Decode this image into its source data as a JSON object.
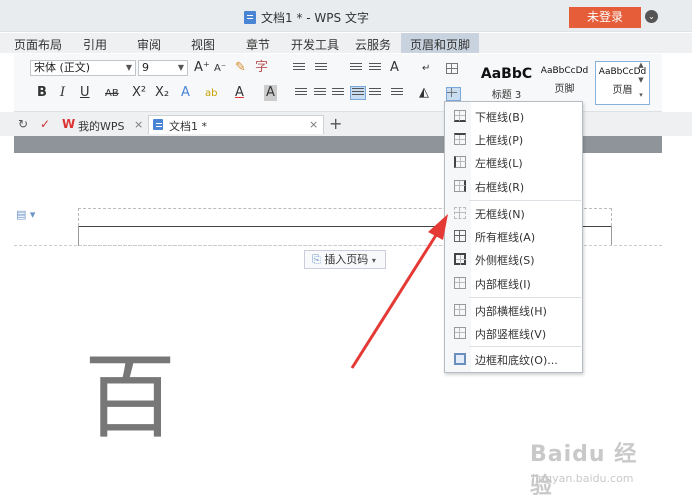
{
  "window": {
    "title": "文档1 * - WPS 文字",
    "login_label": "未登录",
    "fold_icon": "chevron-down-circle-icon"
  },
  "menu": {
    "items": [
      "页面布局",
      "引用",
      "审阅",
      "视图",
      "章节",
      "开发工具",
      "云服务",
      "页眉和页脚"
    ],
    "active": "页眉和页脚"
  },
  "ribbon": {
    "font_name": "宋体 (正文)",
    "font_size": "9",
    "grow_font": "A⁺",
    "shrink_font": "A⁻",
    "bold": "B",
    "italic": "I",
    "underline": "U",
    "strike": "AB",
    "superscript": "X²",
    "subscript": "X₂",
    "text_effect": "A",
    "highlight": "ab",
    "font_color": "A",
    "char_shading": "A",
    "styles": [
      {
        "sample": "AaBbC",
        "name": "标题 3"
      },
      {
        "sample": "AaBbCcDd",
        "name": "页脚"
      },
      {
        "sample": "AaBbCcDd",
        "name": "页眉"
      }
    ],
    "accent": "#4a84d4"
  },
  "tabs": {
    "cloud_label": "我的WPS",
    "doc_label": "文档1 *",
    "close_glyph": "×",
    "add_glyph": "+"
  },
  "document": {
    "insert_page_number": "插入页码",
    "big_char": "百"
  },
  "border_menu": {
    "items": [
      {
        "label": "下框线(B)",
        "icon": "bottom-border-icon"
      },
      {
        "label": "上框线(P)",
        "icon": "top-border-icon"
      },
      {
        "label": "左框线(L)",
        "icon": "left-border-icon"
      },
      {
        "label": "右框线(R)",
        "icon": "right-border-icon"
      },
      {
        "label": "无框线(N)",
        "icon": "no-border-icon"
      },
      {
        "label": "所有框线(A)",
        "icon": "all-borders-icon"
      },
      {
        "label": "外侧框线(S)",
        "icon": "outside-borders-icon"
      },
      {
        "label": "内部框线(I)",
        "icon": "inside-borders-icon"
      },
      {
        "label": "内部横框线(H)",
        "icon": "inside-horizontal-border-icon"
      },
      {
        "label": "内部竖框线(V)",
        "icon": "inside-vertical-border-icon"
      },
      {
        "label": "边框和底纹(O)...",
        "icon": "borders-and-shading-icon"
      }
    ]
  },
  "annotation": {
    "arrow_color": "#e53935"
  },
  "watermark": {
    "logo": "Baidu 经验",
    "url": "jingyan.baidu.com"
  }
}
